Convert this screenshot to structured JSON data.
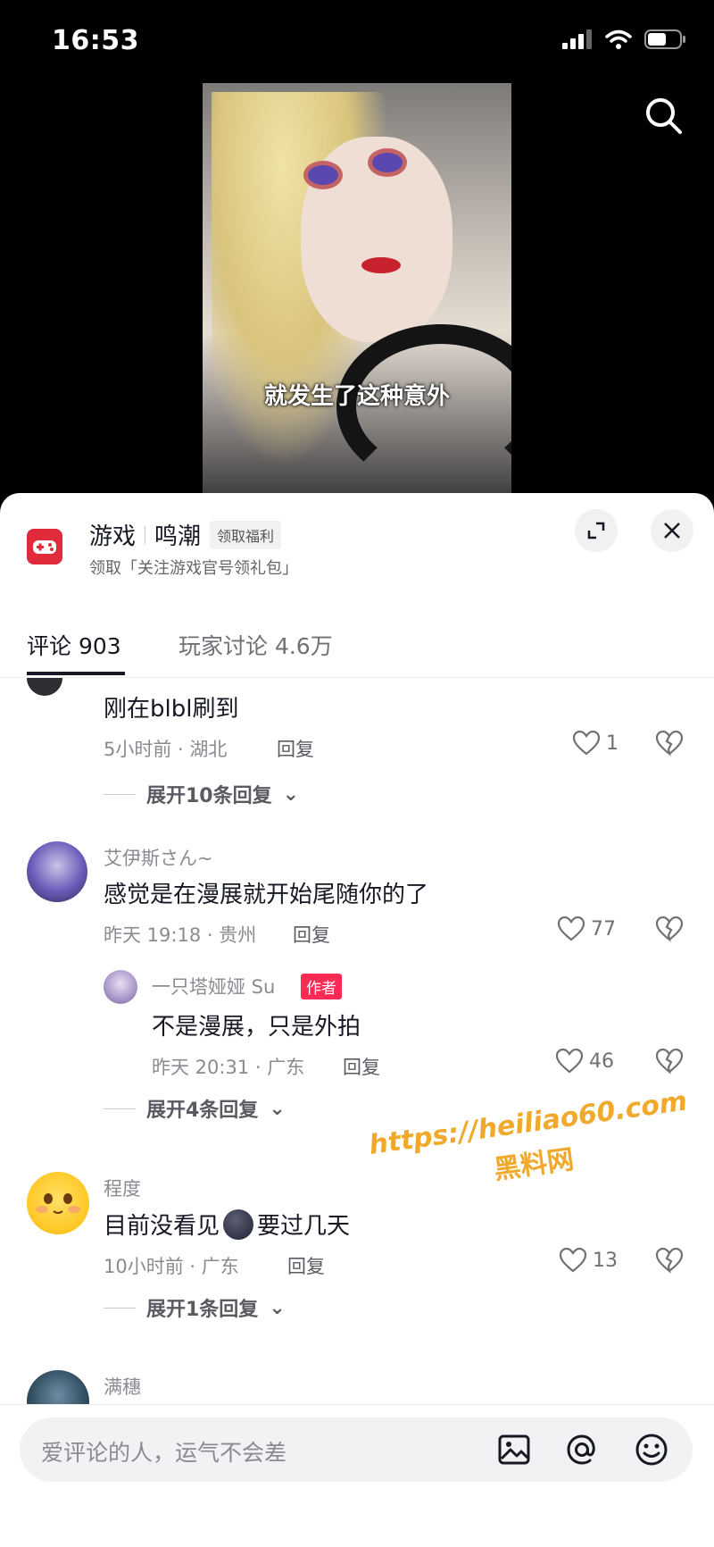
{
  "status_bar": {
    "time": "16:53"
  },
  "video": {
    "subtitle": "就发生了这种意外"
  },
  "game_panel": {
    "category": "游戏",
    "game_name": "鸣潮",
    "benefit_pill": "领取福利",
    "subtitle": "领取「关注游戏官号领礼包」"
  },
  "tabs": [
    {
      "label": "评论 903"
    },
    {
      "label": "玩家讨论 4.6万"
    }
  ],
  "comments": [
    {
      "text": "刚在blbl刷到",
      "time_loc": "5小时前 · 湖北",
      "reply": "回复",
      "likes": "1",
      "expand": "展开10条回复"
    },
    {
      "user": "艾伊斯さん~",
      "text": "感觉是在漫展就开始尾随你的了",
      "time_loc": "昨天 19:18 · 贵州",
      "reply": "回复",
      "likes": "77"
    },
    {
      "user": "一只塔娅娅 Su",
      "author_tag": "作者",
      "text": "不是漫展，只是外拍",
      "time_loc": "昨天 20:31 · 广东",
      "reply": "回复",
      "likes": "46",
      "expand": "展开4条回复"
    },
    {
      "user": "程度",
      "text_before": "目前没看见",
      "text_after": "要过几天",
      "time_loc": "10小时前 · 广东",
      "reply": "回复",
      "likes": "13",
      "expand": "展开1条回复"
    },
    {
      "user": "满穗"
    }
  ],
  "watermark": {
    "url": "https://heiliao60.com",
    "name": "黑料网"
  },
  "input": {
    "placeholder": "爱评论的人，运气不会差"
  }
}
